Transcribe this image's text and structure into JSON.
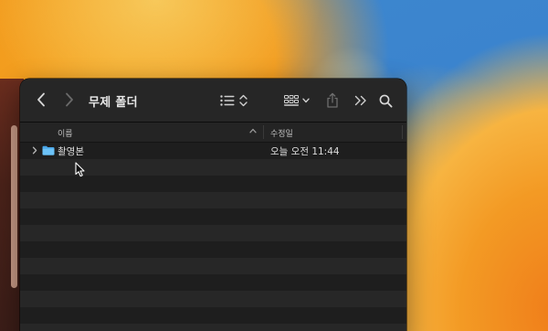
{
  "window": {
    "title": "무제 폴더"
  },
  "toolbar": {
    "back_icon": "chevron-left-icon",
    "forward_icon": "chevron-right-icon",
    "view_list_icon": "list-view-icon",
    "view_options_icon": "updown-chevron-icon",
    "group_icon": "grid-group-icon",
    "share_icon": "share-icon",
    "more_icon": "double-chevron-right-icon",
    "search_icon": "search-icon"
  },
  "columns": {
    "name": "이름",
    "date_modified": "수정일"
  },
  "files": [
    {
      "name": "촬영본",
      "date_modified": "오늘 오전 11:44",
      "kind": "folder"
    }
  ],
  "colors": {
    "folder_blue": "#5bb4f0",
    "window_bg": "#1e1e1e",
    "row_alt": "#272727"
  }
}
